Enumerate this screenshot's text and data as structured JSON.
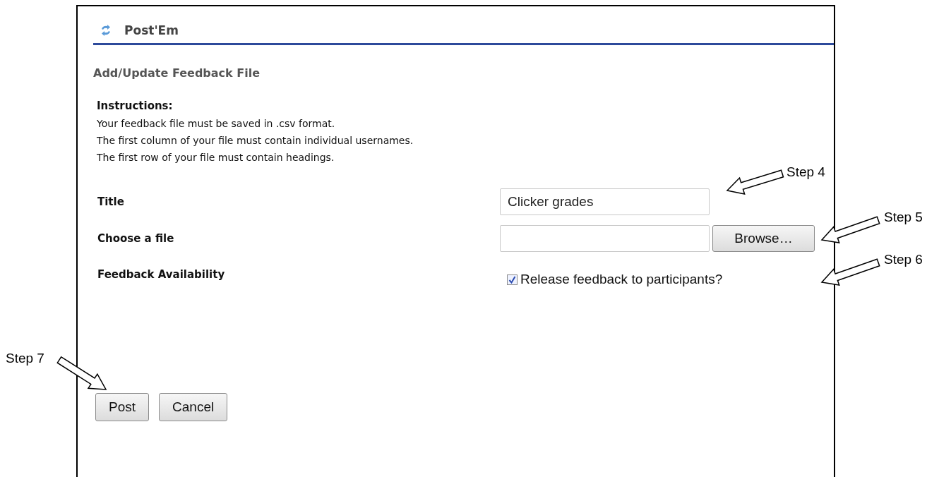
{
  "header": {
    "title": "Post'Em"
  },
  "page_title": "Add/Update Feedback File",
  "instructions": {
    "heading": "Instructions:",
    "lines": [
      "Your feedback file must be saved in .csv format.",
      "The first column of your file must contain individual usernames.",
      "The first row of your file must contain headings."
    ]
  },
  "form": {
    "title": {
      "label": "Title",
      "value": "Clicker grades"
    },
    "file": {
      "label": "Choose a file",
      "button": "Browse…"
    },
    "availability": {
      "label": "Feedback Availability",
      "option": "Release feedback to participants?",
      "checked": true
    }
  },
  "buttons": [
    "Post",
    "Cancel"
  ],
  "annotations": [
    {
      "label": "Step 4"
    },
    {
      "label": "Step 5"
    },
    {
      "label": "Step 6"
    },
    {
      "label": "Step 7"
    }
  ]
}
